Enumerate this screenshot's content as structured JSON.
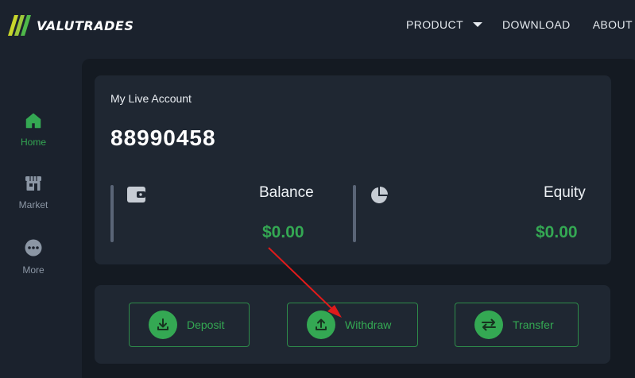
{
  "brand": {
    "name": "VALUTRADES"
  },
  "nav": {
    "product": "PRODUCT",
    "download": "DOWNLOAD",
    "about": "ABOUT"
  },
  "sidebar": {
    "items": [
      {
        "label": "Home",
        "icon": "home-icon",
        "active": true
      },
      {
        "label": "Market",
        "icon": "market-icon",
        "active": false
      },
      {
        "label": "More",
        "icon": "more-icon",
        "active": false
      }
    ]
  },
  "account": {
    "title": "My Live Account",
    "number": "88990458",
    "balance_label": "Balance",
    "balance_value": "$0.00",
    "equity_label": "Equity",
    "equity_value": "$0.00"
  },
  "actions": {
    "deposit": "Deposit",
    "withdraw": "Withdraw",
    "transfer": "Transfer"
  },
  "colors": {
    "accent": "#34a853",
    "background": "#1b222d",
    "card": "#1f2732",
    "annotation_arrow": "#e01b1b"
  }
}
